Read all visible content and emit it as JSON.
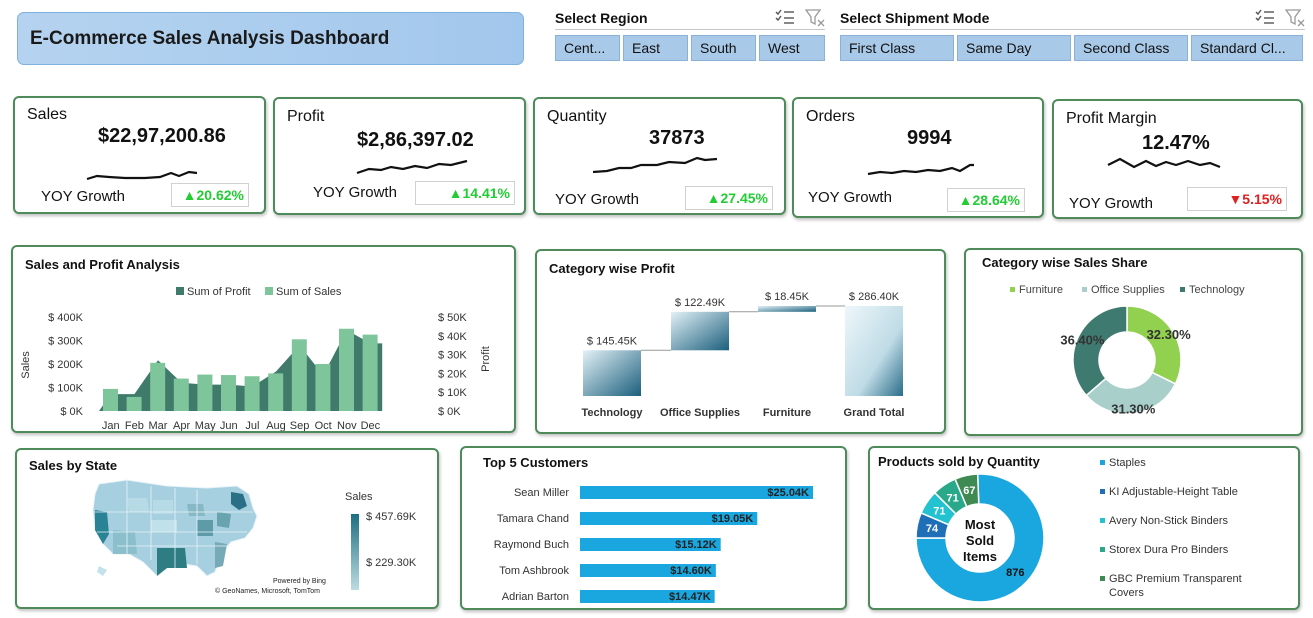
{
  "title": "E-Commerce Sales Analysis Dashboard",
  "slicers": {
    "region": {
      "title": "Select Region",
      "options": [
        "Cent...",
        "East",
        "South",
        "West"
      ]
    },
    "shipment": {
      "title": "Select Shipment Mode",
      "options": [
        "First Class",
        "Same Day",
        "Second Class",
        "Standard Cl..."
      ]
    }
  },
  "kpis": [
    {
      "label": "Sales",
      "value": "$22,97,200.86",
      "yoy_label": "YOY Growth",
      "growth": "▲20.62%",
      "direction": "up"
    },
    {
      "label": "Profit",
      "value": "$2,86,397.02",
      "yoy_label": "YOY Growth",
      "growth": "▲14.41%",
      "direction": "up"
    },
    {
      "label": "Quantity",
      "value": "37873",
      "yoy_label": "YOY Growth",
      "growth": "▲27.45%",
      "direction": "up"
    },
    {
      "label": "Orders",
      "value": "9994",
      "yoy_label": "YOY Growth",
      "growth": "▲28.64%",
      "direction": "up"
    },
    {
      "label": "Profit Margin",
      "value": "12.47%",
      "yoy_label": "YOY Growth",
      "growth": "▼5.15%",
      "direction": "down"
    }
  ],
  "colors": {
    "up": "#22cc33",
    "down": "#e02020",
    "panel_border": "#4e8a5a",
    "profit": "#3f7a6b",
    "sales": "#7ec59c",
    "customer_bar": "#1aa7e0"
  },
  "panels": {
    "sales_profit": "Sales and Profit Analysis",
    "category_profit": "Category wise Profit",
    "category_share": "Category wise Sales Share",
    "sales_by_state": "Sales by State",
    "top_customers": "Top 5 Customers",
    "products_qty": "Products sold by Quantity"
  },
  "chart_data": [
    {
      "type": "bar",
      "title": "Sales and Profit Analysis",
      "categories": [
        "Jan",
        "Feb",
        "Mar",
        "Apr",
        "May",
        "Jun",
        "Jul",
        "Aug",
        "Sep",
        "Oct",
        "Nov",
        "Dec"
      ],
      "series": [
        {
          "name": "Sum of Sales",
          "chart": "bar",
          "axis": "left",
          "values": [
            94000,
            60000,
            205000,
            138000,
            155000,
            153000,
            148000,
            160000,
            305000,
            200000,
            350000,
            325000
          ]
        },
        {
          "name": "Sum of Profit",
          "chart": "area",
          "axis": "right",
          "values": [
            9000,
            9000,
            27000,
            15000,
            14000,
            14000,
            13000,
            21000,
            35000,
            19000,
            43000,
            36000
          ]
        }
      ],
      "ylabel": "Sales",
      "y2label": "Profit",
      "left_ticks": [
        "$ 0K",
        "$ 100K",
        "$ 200K",
        "$ 300K",
        "$ 400K"
      ],
      "right_ticks": [
        "$ 0K",
        "$ 10K",
        "$ 20K",
        "$ 30K",
        "$ 40K",
        "$ 50K"
      ],
      "ylim": [
        0,
        400000
      ],
      "y2lim": [
        0,
        50000
      ],
      "legend": "top"
    },
    {
      "type": "bar",
      "subtype": "waterfall",
      "title": "Category wise Profit",
      "categories": [
        "Technology",
        "Office Supplies",
        "Furniture",
        "Grand Total"
      ],
      "values": [
        145450,
        122490,
        18450,
        286400
      ],
      "labels": [
        "$ 145.45K",
        "$ 122.49K",
        "$ 18.45K",
        "$ 286.40K"
      ]
    },
    {
      "type": "pie",
      "subtype": "donut",
      "title": "Category wise Sales Share",
      "categories": [
        "Furniture",
        "Office Supplies",
        "Technology"
      ],
      "values": [
        32.3,
        31.3,
        36.4
      ],
      "labels": [
        "32.30%",
        "31.30%",
        "36.40%"
      ],
      "colors": [
        "#92d050",
        "#a9cfcb",
        "#3f7a70"
      ],
      "legend": "top"
    },
    {
      "type": "bar",
      "orientation": "horizontal",
      "title": "Top 5 Customers",
      "categories": [
        "Sean Miller",
        "Tamara Chand",
        "Raymond Buch",
        "Tom Ashbrook",
        "Adrian Barton"
      ],
      "values": [
        25040,
        19050,
        15120,
        14600,
        14470
      ],
      "labels": [
        "$25.04K",
        "$19.05K",
        "$15.12K",
        "$14.60K",
        "$14.47K"
      ]
    },
    {
      "type": "pie",
      "subtype": "donut",
      "title": "Products sold by Quantity",
      "center_label": "Most Sold Items",
      "categories": [
        "Staples",
        "KI Adjustable-Height Table",
        "Avery Non-Stick Binders",
        "Storex Dura Pro Binders",
        "GBC Premium Transparent Covers"
      ],
      "values": [
        876,
        74,
        71,
        71,
        67
      ],
      "colors": [
        "#1aa7e0",
        "#1f6fb8",
        "#23c2d0",
        "#2aa88a",
        "#3e8a52"
      ]
    }
  ],
  "map": {
    "legend_title": "Sales",
    "legend_max": "$ 457.69K",
    "legend_mid": "$ 229.30K",
    "credit_1": "Powered by Bing",
    "credit_2": "© GeoNames, Microsoft, TomTom"
  }
}
